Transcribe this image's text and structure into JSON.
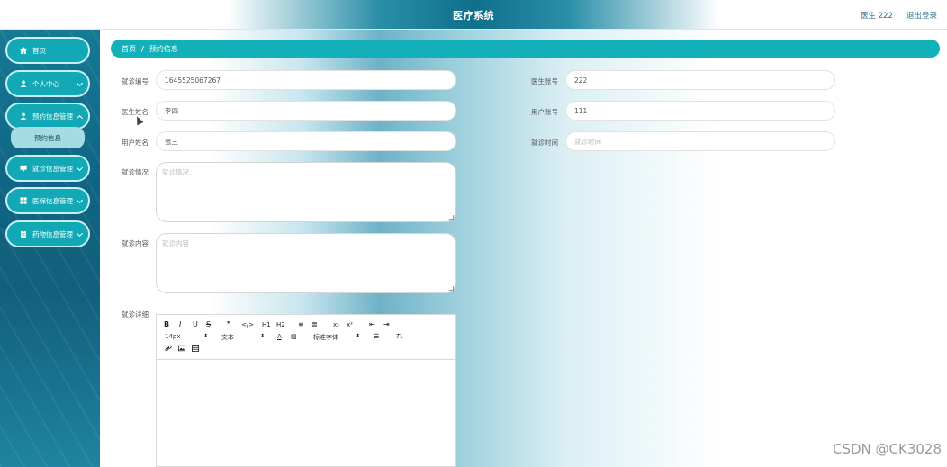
{
  "header": {
    "title": "医疗系统",
    "user": "医生 222",
    "logout": "退出登录"
  },
  "sidebar": {
    "items": [
      {
        "label": "首页",
        "icon": "home-icon"
      },
      {
        "label": "个人中心",
        "icon": "user-icon"
      },
      {
        "label": "预约信息管理",
        "icon": "user-icon"
      },
      {
        "label": "就诊信息管理",
        "icon": "monitor-icon"
      },
      {
        "label": "医保信息管理",
        "icon": "grid-icon"
      },
      {
        "label": "药物信息管理",
        "icon": "clipboard-icon"
      }
    ],
    "submenu": {
      "label": "预约信息"
    }
  },
  "breadcrumb": {
    "home": "首页",
    "separator": "/",
    "current": "预约信息"
  },
  "form": {
    "visit_no": {
      "label": "就诊编号",
      "value": "1645525067267"
    },
    "doctor_account": {
      "label": "医生账号",
      "value": "222"
    },
    "doctor_name": {
      "label": "医生姓名",
      "value": "李四"
    },
    "user_account": {
      "label": "用户账号",
      "value": "111"
    },
    "user_name": {
      "label": "用户姓名",
      "value": "张三"
    },
    "visit_time": {
      "label": "就诊时间",
      "placeholder": "就诊时间"
    },
    "visit_status": {
      "label": "就诊情况",
      "placeholder": "就诊情况"
    },
    "visit_content": {
      "label": "就诊内容",
      "placeholder": "就诊内容"
    },
    "visit_detail": {
      "label": "就诊详细"
    }
  },
  "editor": {
    "toolbar_row1": [
      "B",
      "I",
      "U",
      "S",
      "❞",
      "</>",
      "H1",
      "H2",
      "≡",
      "≣",
      "x₂",
      "x²",
      "⇤",
      "⇥"
    ],
    "font_size": "14px",
    "text_style": "文本",
    "font_family": "标准字体",
    "align_icon": "align-icon",
    "clear_icon": "clear-format-icon"
  },
  "watermark": "CSDN @CK3028"
}
